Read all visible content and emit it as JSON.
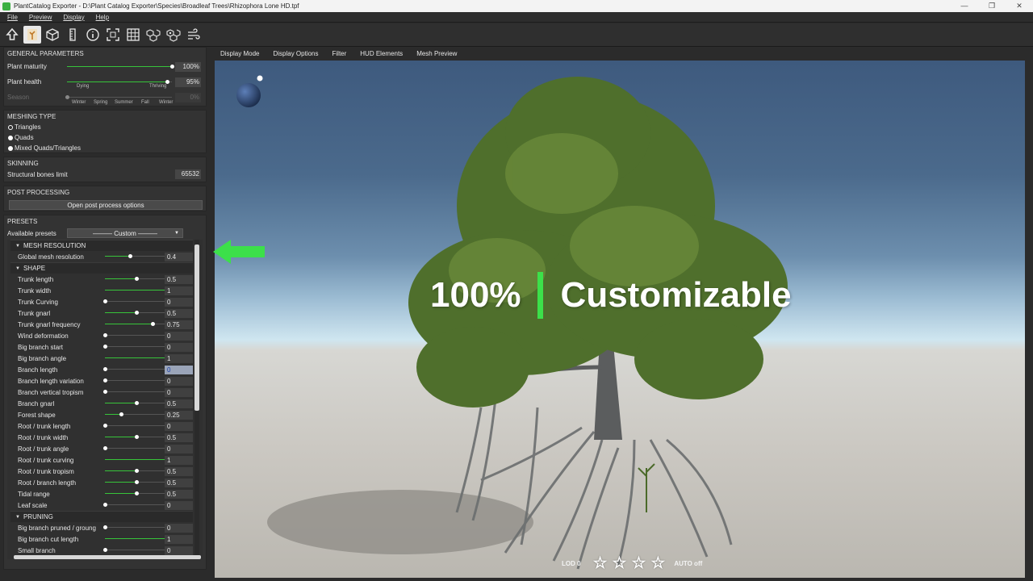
{
  "window": {
    "title": "PlantCatalog Exporter - D:\\Plant Catalog Exporter\\Species\\Broadleaf Trees\\Rhizophora Lone HD.tpf",
    "controls": [
      "—",
      "❐",
      "✕"
    ]
  },
  "menu": [
    "File",
    "Preview",
    "Display",
    "Help"
  ],
  "toolbar": {
    "icons": [
      "upload-icon",
      "plant-icon",
      "cube-icon",
      "ruler-icon",
      "info-icon",
      "focus-icon",
      "grid-icon",
      "cubes-icon",
      "texture-cubes-icon",
      "wind-icon"
    ],
    "active": "plant-icon"
  },
  "general": {
    "title": "GENERAL PARAMETERS",
    "maturity": {
      "label": "Plant maturity",
      "value": "100%",
      "fraction": 1.0
    },
    "health": {
      "label": "Plant health",
      "value": "95%",
      "fraction": 0.95,
      "min_label": "Dying",
      "max_label": "Thriving"
    },
    "season": {
      "label": "Season",
      "value": "0%",
      "fraction": 0.0,
      "ticks": [
        "Winter",
        "Spring",
        "Summer",
        "Fall",
        "Winter"
      ]
    }
  },
  "meshing": {
    "title": "MESHING TYPE",
    "options": [
      {
        "label": "Triangles",
        "selected": false
      },
      {
        "label": "Quads",
        "selected": true
      },
      {
        "label": "Mixed Quads/Triangles",
        "selected": true
      }
    ]
  },
  "skinning": {
    "title": "SKINNING",
    "label": "Structural bones limit",
    "value": "65532"
  },
  "post": {
    "title": "POST PROCESSING",
    "button": "Open post process options"
  },
  "presets": {
    "title": "PRESETS",
    "label": "Available presets",
    "selected": "——— Custom ———",
    "groups": [
      {
        "title": "MESH RESOLUTION",
        "params": [
          {
            "label": "Global mesh resolution",
            "value": "0.4",
            "fraction": 0.4
          }
        ]
      },
      {
        "title": "SHAPE",
        "params": [
          {
            "label": "Trunk length",
            "value": "0.5",
            "fraction": 0.5
          },
          {
            "label": "Trunk width",
            "value": "1",
            "fraction": 1.0
          },
          {
            "label": "Trunk Curving",
            "value": "0",
            "fraction": 0.0
          },
          {
            "label": "Trunk gnarl",
            "value": "0.5",
            "fraction": 0.5
          },
          {
            "label": "Trunk gnarl frequency",
            "value": "0.75",
            "fraction": 0.75
          },
          {
            "label": "Wind deformation",
            "value": "0",
            "fraction": 0.0
          },
          {
            "label": "Big branch start",
            "value": "0",
            "fraction": 0.0
          },
          {
            "label": "Big branch angle",
            "value": "1",
            "fraction": 1.0
          },
          {
            "label": "Branch length",
            "value": "0",
            "fraction": 0.0,
            "selected": true
          },
          {
            "label": "Branch length variation",
            "value": "0",
            "fraction": 0.0
          },
          {
            "label": "Branch vertical tropism",
            "value": "0",
            "fraction": 0.0
          },
          {
            "label": "Branch gnarl",
            "value": "0.5",
            "fraction": 0.5
          },
          {
            "label": "Forest shape",
            "value": "0.25",
            "fraction": 0.25
          },
          {
            "label": "Root / trunk length",
            "value": "0",
            "fraction": 0.0
          },
          {
            "label": "Root / trunk width",
            "value": "0.5",
            "fraction": 0.5
          },
          {
            "label": "Root / trunk angle",
            "value": "0",
            "fraction": 0.0
          },
          {
            "label": "Root / trunk curving",
            "value": "1",
            "fraction": 1.0
          },
          {
            "label": "Root / trunk  tropism",
            "value": "0.5",
            "fraction": 0.5
          },
          {
            "label": "Root / branch length",
            "value": "0.5",
            "fraction": 0.5
          },
          {
            "label": "Tidal range",
            "value": "0.5",
            "fraction": 0.5
          },
          {
            "label": "Leaf scale",
            "value": "0",
            "fraction": 0.0
          }
        ]
      },
      {
        "title": "PRUNING",
        "params": [
          {
            "label": "Big branch pruned / groung",
            "value": "0",
            "fraction": 0.0
          },
          {
            "label": "Big branch cut length",
            "value": "1",
            "fraction": 1.0
          },
          {
            "label": "Small branch",
            "value": "0",
            "fraction": 0.0
          }
        ]
      }
    ]
  },
  "viewport": {
    "tabs": [
      "Display Mode",
      "Display Options",
      "Filter",
      "HUD Elements",
      "Mesh Preview"
    ],
    "overlay_left": "100%",
    "overlay_right": "Customizable",
    "hud": {
      "lod": "LOD 0",
      "stars": 4,
      "auto": "AUTO off"
    }
  },
  "colors": {
    "accent": "#37c43a",
    "overlay_bar": "#3ce04a",
    "arrow": "#3ce04a"
  }
}
